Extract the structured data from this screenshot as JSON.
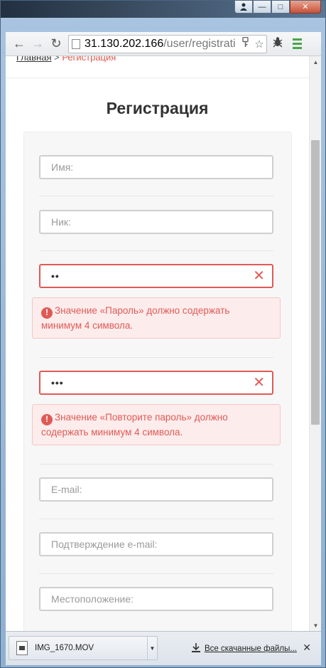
{
  "window": {
    "user_icon": "user-icon",
    "minimize": "—",
    "maximize": "□",
    "close": "✕"
  },
  "toolbar": {
    "back": "←",
    "forward": "→",
    "reload": "↻",
    "url_host": "31.130.202.166",
    "url_path": "/user/registrati",
    "key_icon": "key-icon",
    "star": "☆",
    "extension": "bug-extension-icon"
  },
  "breadcrumb": {
    "home": "Главная",
    "separator": " > ",
    "current": "Регистрация"
  },
  "page": {
    "title": "Регистрация"
  },
  "form": {
    "name_placeholder": "Имя:",
    "nick_placeholder": "Ник:",
    "password_value": "••",
    "password_error": "Значение «Пароль» должно содержать минимум 4 символа.",
    "repeat_value": "•••",
    "repeat_error": "Значение «Повторите пароль» должно содержать минимум 4 символа.",
    "email_placeholder": "E-mail:",
    "email_confirm_placeholder": "Подтверждение e-mail:",
    "location_placeholder": "Местоположение:",
    "clear_symbol": "✕",
    "error_symbol": "!"
  },
  "downloads": {
    "file_name": "IMG_1670.MOV",
    "dropdown": "▼",
    "all_downloads": "Все скачанные файлы...",
    "close": "✕"
  },
  "colors": {
    "error": "#e05a55",
    "error_bg": "#fdecec",
    "menu_green": "#48a64a"
  }
}
